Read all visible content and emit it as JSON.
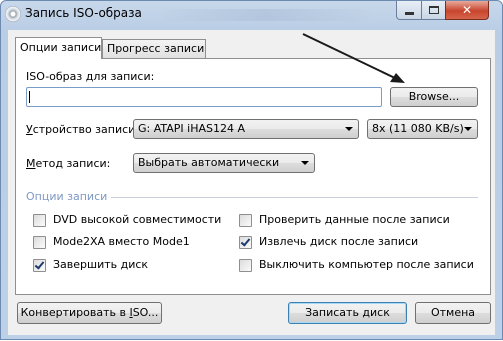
{
  "window": {
    "title": "Запись ISO-образа"
  },
  "tabs": [
    {
      "label": "Опции записи",
      "active": true
    },
    {
      "label": "Прогресс записи",
      "active": false
    }
  ],
  "iso": {
    "label": "ISO-образ для записи:",
    "value": "",
    "browse_label": "Browse..."
  },
  "device": {
    "label": "Устройство записи:",
    "selected": "G: ATAPI iHAS124   A",
    "speed": "8x (11 080 KB/s)"
  },
  "method": {
    "label": "Метод записи:",
    "selected": "Выбрать автоматически"
  },
  "options": {
    "group_label": "Опции записи",
    "items": [
      {
        "label": "DVD высокой совместимости",
        "checked": false
      },
      {
        "label": "Проверить данные после записи",
        "checked": false
      },
      {
        "label": "Mode2XA вместо Mode1",
        "checked": false
      },
      {
        "label": "Извлечь диск после записи",
        "checked": true
      },
      {
        "label": "Завершить диск",
        "checked": true
      },
      {
        "label": "Выключить компьютер после записи",
        "checked": false
      }
    ]
  },
  "buttons": {
    "convert": "Конвертировать в ISO...",
    "write": "Записать диск",
    "cancel": "Отмена"
  }
}
